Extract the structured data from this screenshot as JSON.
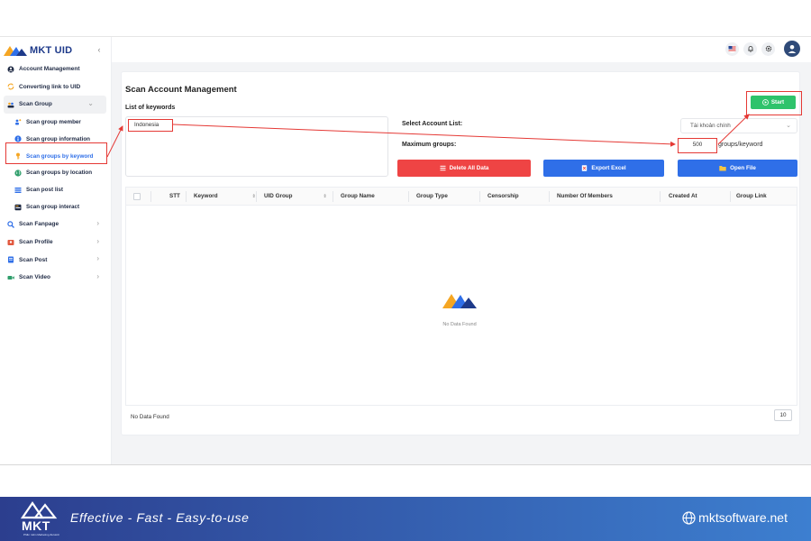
{
  "app": {
    "logo_text": "MKT UID",
    "collapse_glyph": "‹"
  },
  "sidebar": {
    "items": [
      {
        "label": "Account Management",
        "icon": "user-circle-icon"
      },
      {
        "label": "Converting link to UID",
        "icon": "refresh-icon"
      },
      {
        "label": "Scan Group",
        "icon": "group-icon",
        "expanded": true
      },
      {
        "label": "Scan Fanpage",
        "icon": "search-icon"
      },
      {
        "label": "Scan Profile",
        "icon": "profile-icon"
      },
      {
        "label": "Scan Post",
        "icon": "post-icon"
      },
      {
        "label": "Scan Video",
        "icon": "video-icon"
      }
    ],
    "sub_items": [
      {
        "label": "Scan group member",
        "icon": "members-icon"
      },
      {
        "label": "Scan group information",
        "icon": "info-icon"
      },
      {
        "label": "Scan groups by keyword",
        "icon": "key-icon",
        "active": true
      },
      {
        "label": "Scan groups by location",
        "icon": "globe-icon"
      },
      {
        "label": "Scan post list",
        "icon": "list-icon"
      },
      {
        "label": "Scan group interact",
        "icon": "interact-icon"
      }
    ]
  },
  "main": {
    "title": "Scan Account Management",
    "keywords_label": "List of keywords",
    "keyword_value": "Indonesia",
    "account_list_label": "Select Account List:",
    "account_select_value": "Tài khoản chính",
    "max_groups_label": "Maximum groups:",
    "max_groups_value": "500",
    "max_groups_unit": "groups/keyword",
    "start_label": "Start",
    "delete_label": "Delete All Data",
    "export_label": "Export Excel",
    "open_label": "Open File"
  },
  "table": {
    "columns": [
      "STT",
      "Keyword",
      "UID Group",
      "Group Name",
      "Group Type",
      "Censorship",
      "Number Of Members",
      "Created At",
      "Group Link"
    ],
    "empty_text": "No Data Found",
    "footer_text": "No Data Found",
    "page_size": "10"
  },
  "banner": {
    "brand": "MKT",
    "brand_small": "Phần mềm Marketing đa kênh",
    "slogan": "Effective - Fast - Easy-to-use",
    "website": "mktsoftware.net"
  },
  "colors": {
    "primary": "#2f6fe8",
    "danger": "#ef4444",
    "success": "#2ec36b",
    "annotation": "#e53935",
    "banner_start": "#2c3e8e",
    "banner_end": "#3d7fd0"
  }
}
